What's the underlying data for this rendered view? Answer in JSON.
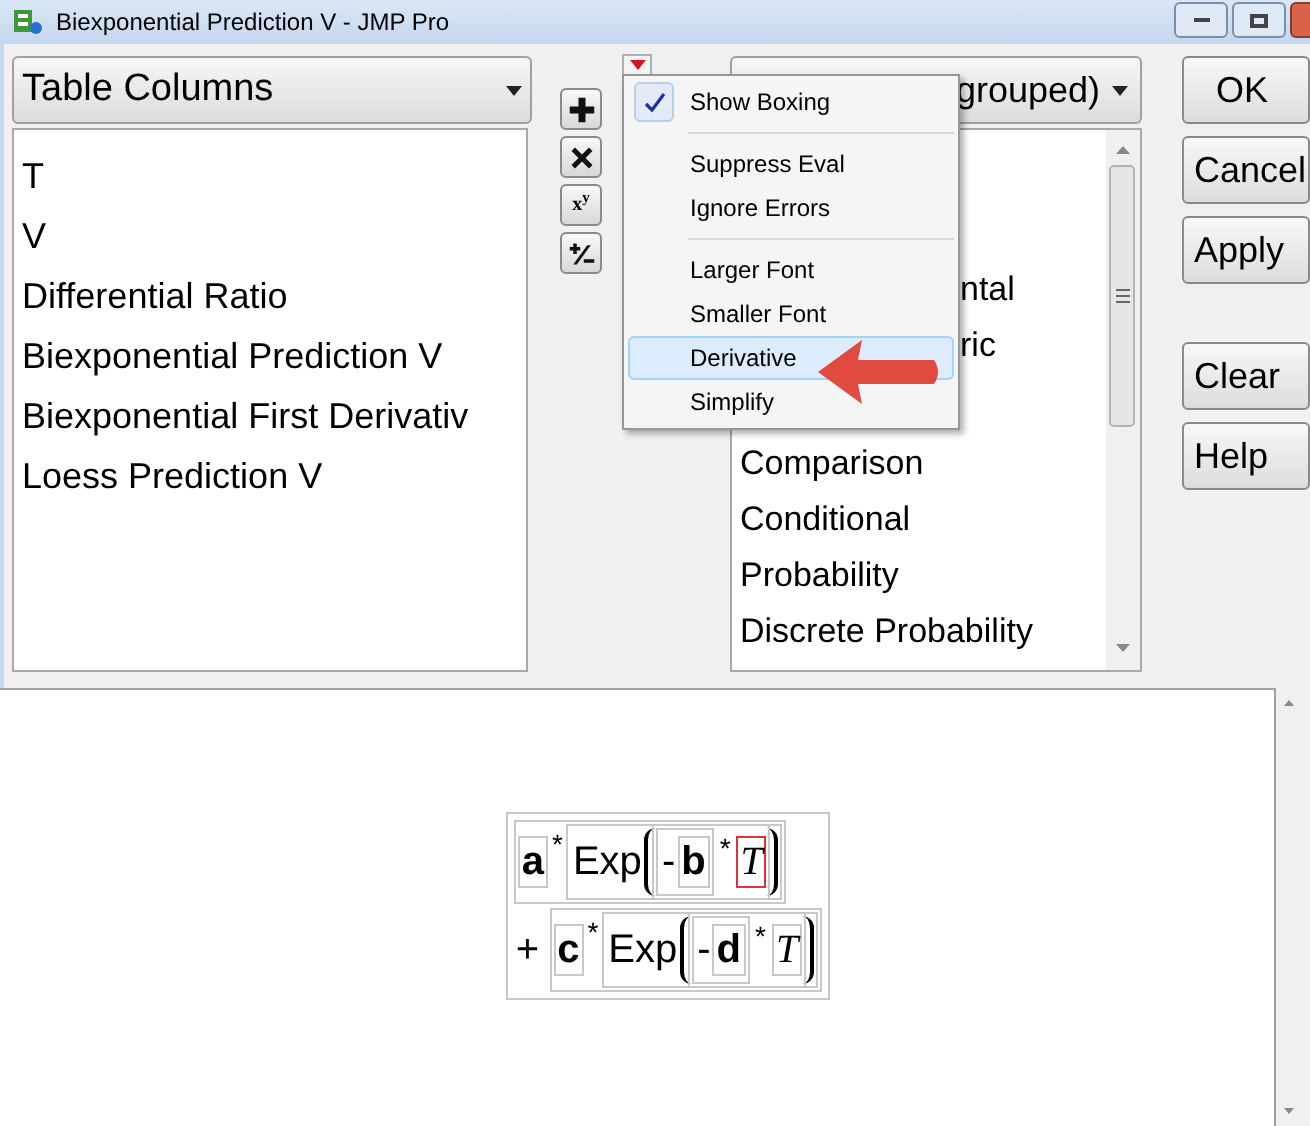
{
  "window": {
    "title": "Biexponential Prediction V - JMP Pro"
  },
  "columns_dropdown": {
    "value": "Table Columns"
  },
  "columns_list": {
    "items": [
      {
        "text": "T"
      },
      {
        "text": "V"
      },
      {
        "text": "Differential Ratio"
      },
      {
        "text": "Biexponential Prediction V"
      },
      {
        "text": "Biexponential First Derivativ"
      },
      {
        "text": "Loess Prediction V"
      }
    ]
  },
  "operator_buttons": [
    {
      "kind": "plus"
    },
    {
      "kind": "times"
    },
    {
      "kind": "power",
      "label": "x$^{y}$"
    },
    {
      "kind": "plusminus"
    }
  ],
  "functions_dropdown": {
    "value": "grouped)"
  },
  "functions_list": {
    "items": [
      {
        "text": "ntal",
        "kind": "cut"
      },
      {
        "text": "ric",
        "kind": "cut"
      },
      {
        "text": "Comparison",
        "kind": "full"
      },
      {
        "text": "Conditional",
        "kind": "full"
      },
      {
        "text": "Probability",
        "kind": "full"
      },
      {
        "text": "Discrete Probability",
        "kind": "full"
      }
    ]
  },
  "buttons": [
    {
      "label": "OK",
      "kind": "main"
    },
    {
      "label": "Cancel",
      "kind": "main"
    },
    {
      "label": "Apply",
      "kind": "main"
    },
    {
      "label": "Clear",
      "kind": "aux"
    },
    {
      "label": "Help",
      "kind": "aux"
    }
  ],
  "menu": {
    "groups": [
      [
        {
          "label": "Show Boxing",
          "checked": true,
          "selected": false
        }
      ],
      [
        {
          "label": "Suppress Eval",
          "checked": false,
          "selected": false
        },
        {
          "label": "Ignore Errors",
          "checked": false,
          "selected": false
        }
      ],
      [
        {
          "label": "Larger Font",
          "checked": false,
          "selected": false
        },
        {
          "label": "Smaller Font",
          "checked": false,
          "selected": false
        },
        {
          "label": "Derivative",
          "checked": false,
          "selected": true
        },
        {
          "label": "Simplify",
          "checked": false,
          "selected": false
        }
      ]
    ]
  },
  "formula": {
    "terms": [
      {
        "coef": "a",
        "op": "*",
        "func": "Exp",
        "neg": "-",
        "rate": "b",
        "op2": "*",
        "var": "T",
        "var_selected": true
      },
      {
        "sign": "+",
        "coef": "c",
        "op": "*",
        "func": "Exp",
        "neg": "-",
        "rate": "d",
        "op2": "*",
        "var": "T",
        "var_selected": false
      }
    ]
  }
}
